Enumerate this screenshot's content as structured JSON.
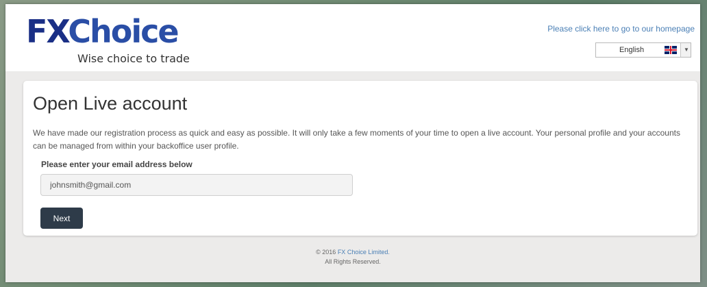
{
  "header": {
    "logo": {
      "brand_fx": "FX",
      "brand_choice": "Choice",
      "tagline": "Wise choice to trade"
    },
    "homepage_link": "Please click here to go to our homepage",
    "language": {
      "selected": "English",
      "flag_icon": "uk-flag-icon",
      "dropdown_icon": "chevron-down-icon"
    }
  },
  "main": {
    "title": "Open Live account",
    "description": "We have made our registration process as quick and easy as possible. It will only take a few moments of your time to open a live account. Your personal profile and your accounts can be managed from within your backoffice user profile.",
    "email_label": "Please enter your email address below",
    "email_value": "johnsmith@gmail.com",
    "next_button": "Next"
  },
  "footer": {
    "copyright_prefix": "© 2016",
    "company_link": "FX Choice Limited.",
    "rights": "All Rights Reserved."
  },
  "colors": {
    "brand_blue": "#1e3f8f",
    "link_blue": "#4a7fb5",
    "button_dark": "#2e3b49"
  }
}
